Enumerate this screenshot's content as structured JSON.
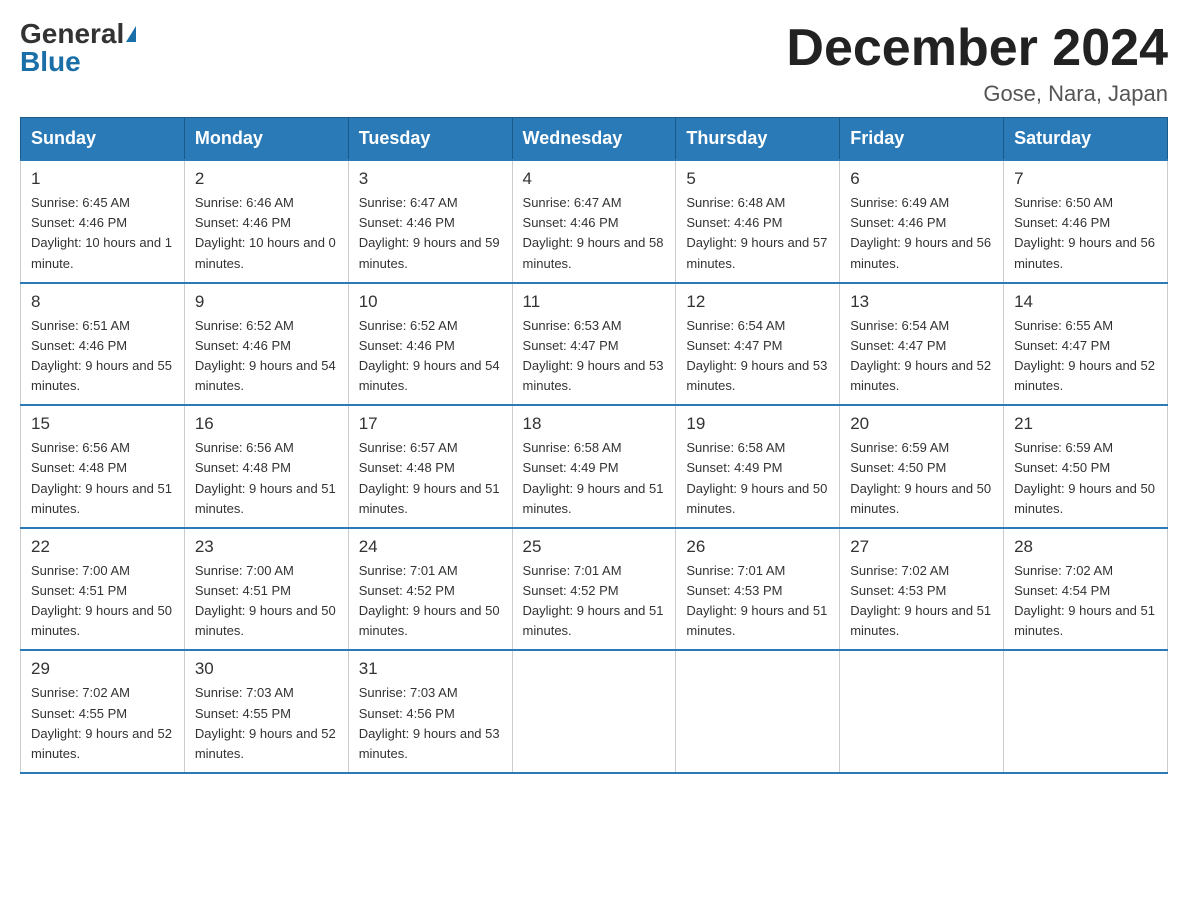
{
  "logo": {
    "general": "General",
    "blue": "Blue"
  },
  "title": "December 2024",
  "location": "Gose, Nara, Japan",
  "days_of_week": [
    "Sunday",
    "Monday",
    "Tuesday",
    "Wednesday",
    "Thursday",
    "Friday",
    "Saturday"
  ],
  "weeks": [
    [
      {
        "day": "1",
        "sunrise": "6:45 AM",
        "sunset": "4:46 PM",
        "daylight": "10 hours and 1 minute."
      },
      {
        "day": "2",
        "sunrise": "6:46 AM",
        "sunset": "4:46 PM",
        "daylight": "10 hours and 0 minutes."
      },
      {
        "day": "3",
        "sunrise": "6:47 AM",
        "sunset": "4:46 PM",
        "daylight": "9 hours and 59 minutes."
      },
      {
        "day": "4",
        "sunrise": "6:47 AM",
        "sunset": "4:46 PM",
        "daylight": "9 hours and 58 minutes."
      },
      {
        "day": "5",
        "sunrise": "6:48 AM",
        "sunset": "4:46 PM",
        "daylight": "9 hours and 57 minutes."
      },
      {
        "day": "6",
        "sunrise": "6:49 AM",
        "sunset": "4:46 PM",
        "daylight": "9 hours and 56 minutes."
      },
      {
        "day": "7",
        "sunrise": "6:50 AM",
        "sunset": "4:46 PM",
        "daylight": "9 hours and 56 minutes."
      }
    ],
    [
      {
        "day": "8",
        "sunrise": "6:51 AM",
        "sunset": "4:46 PM",
        "daylight": "9 hours and 55 minutes."
      },
      {
        "day": "9",
        "sunrise": "6:52 AM",
        "sunset": "4:46 PM",
        "daylight": "9 hours and 54 minutes."
      },
      {
        "day": "10",
        "sunrise": "6:52 AM",
        "sunset": "4:46 PM",
        "daylight": "9 hours and 54 minutes."
      },
      {
        "day": "11",
        "sunrise": "6:53 AM",
        "sunset": "4:47 PM",
        "daylight": "9 hours and 53 minutes."
      },
      {
        "day": "12",
        "sunrise": "6:54 AM",
        "sunset": "4:47 PM",
        "daylight": "9 hours and 53 minutes."
      },
      {
        "day": "13",
        "sunrise": "6:54 AM",
        "sunset": "4:47 PM",
        "daylight": "9 hours and 52 minutes."
      },
      {
        "day": "14",
        "sunrise": "6:55 AM",
        "sunset": "4:47 PM",
        "daylight": "9 hours and 52 minutes."
      }
    ],
    [
      {
        "day": "15",
        "sunrise": "6:56 AM",
        "sunset": "4:48 PM",
        "daylight": "9 hours and 51 minutes."
      },
      {
        "day": "16",
        "sunrise": "6:56 AM",
        "sunset": "4:48 PM",
        "daylight": "9 hours and 51 minutes."
      },
      {
        "day": "17",
        "sunrise": "6:57 AM",
        "sunset": "4:48 PM",
        "daylight": "9 hours and 51 minutes."
      },
      {
        "day": "18",
        "sunrise": "6:58 AM",
        "sunset": "4:49 PM",
        "daylight": "9 hours and 51 minutes."
      },
      {
        "day": "19",
        "sunrise": "6:58 AM",
        "sunset": "4:49 PM",
        "daylight": "9 hours and 50 minutes."
      },
      {
        "day": "20",
        "sunrise": "6:59 AM",
        "sunset": "4:50 PM",
        "daylight": "9 hours and 50 minutes."
      },
      {
        "day": "21",
        "sunrise": "6:59 AM",
        "sunset": "4:50 PM",
        "daylight": "9 hours and 50 minutes."
      }
    ],
    [
      {
        "day": "22",
        "sunrise": "7:00 AM",
        "sunset": "4:51 PM",
        "daylight": "9 hours and 50 minutes."
      },
      {
        "day": "23",
        "sunrise": "7:00 AM",
        "sunset": "4:51 PM",
        "daylight": "9 hours and 50 minutes."
      },
      {
        "day": "24",
        "sunrise": "7:01 AM",
        "sunset": "4:52 PM",
        "daylight": "9 hours and 50 minutes."
      },
      {
        "day": "25",
        "sunrise": "7:01 AM",
        "sunset": "4:52 PM",
        "daylight": "9 hours and 51 minutes."
      },
      {
        "day": "26",
        "sunrise": "7:01 AM",
        "sunset": "4:53 PM",
        "daylight": "9 hours and 51 minutes."
      },
      {
        "day": "27",
        "sunrise": "7:02 AM",
        "sunset": "4:53 PM",
        "daylight": "9 hours and 51 minutes."
      },
      {
        "day": "28",
        "sunrise": "7:02 AM",
        "sunset": "4:54 PM",
        "daylight": "9 hours and 51 minutes."
      }
    ],
    [
      {
        "day": "29",
        "sunrise": "7:02 AM",
        "sunset": "4:55 PM",
        "daylight": "9 hours and 52 minutes."
      },
      {
        "day": "30",
        "sunrise": "7:03 AM",
        "sunset": "4:55 PM",
        "daylight": "9 hours and 52 minutes."
      },
      {
        "day": "31",
        "sunrise": "7:03 AM",
        "sunset": "4:56 PM",
        "daylight": "9 hours and 53 minutes."
      },
      null,
      null,
      null,
      null
    ]
  ]
}
